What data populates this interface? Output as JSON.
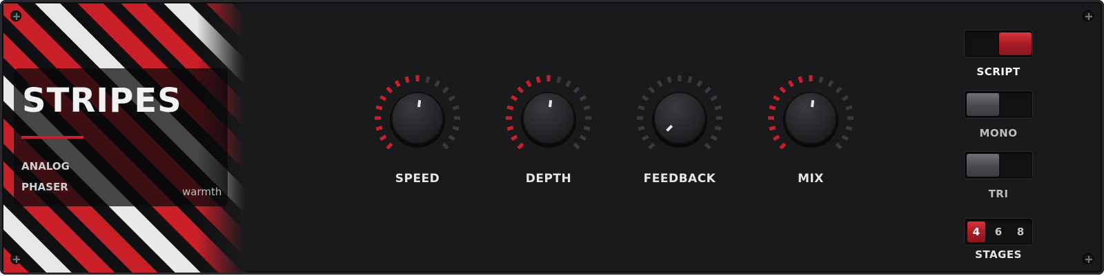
{
  "brand": {
    "title": "STRIPES",
    "line1": "ANALOG",
    "line2": "PHASER",
    "tag": "warmth"
  },
  "knobs": [
    {
      "label": "SPEED",
      "active_ticks": 10,
      "total_ticks": 19
    },
    {
      "label": "DEPTH",
      "active_ticks": 10,
      "total_ticks": 19
    },
    {
      "label": "FEEDBACK",
      "active_ticks": 0,
      "total_ticks": 19
    },
    {
      "label": "MIX",
      "active_ticks": 10,
      "total_ticks": 19
    }
  ],
  "switches": {
    "script": {
      "label": "SCRIPT",
      "on": true
    },
    "mono": {
      "label": "MONO",
      "on": false
    },
    "tri": {
      "label": "TRI",
      "on": false
    }
  },
  "stages": {
    "label": "STAGES",
    "options": [
      "4",
      "6",
      "8"
    ],
    "selected": "4"
  },
  "colors": {
    "accent": "#c9202a",
    "panel": "#1a1a1d",
    "tick_off": "#3a3a3e",
    "label_on": "#ffffff",
    "label_off": "#bdbdbd"
  },
  "icons": [
    "screw-icon"
  ]
}
